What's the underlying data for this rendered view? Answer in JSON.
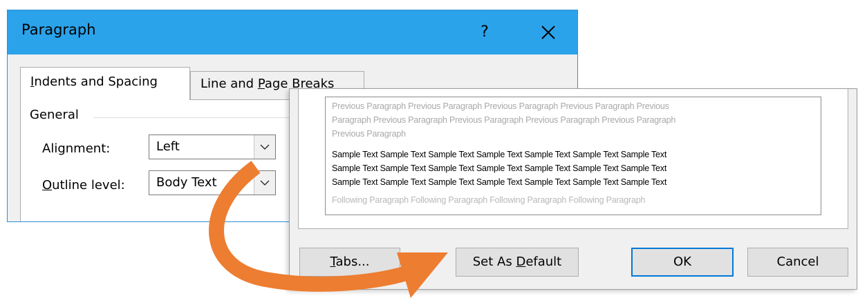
{
  "dialog": {
    "title": "Paragraph",
    "help_label": "?",
    "tabs": [
      {
        "pre": "",
        "ul": "I",
        "post": "ndents and Spacing"
      },
      {
        "pre": "Line and ",
        "ul": "P",
        "post": "age Breaks"
      }
    ],
    "general": {
      "group_label": "General",
      "alignment": {
        "pre": "Ali",
        "ul": "g",
        "post": "nment:",
        "value": "Left"
      },
      "outline_level": {
        "pre": "",
        "ul": "O",
        "post": "utline level:",
        "value": "Body Text"
      }
    }
  },
  "preview": {
    "previous_lines": [
      "Previous Paragraph Previous Paragraph Previous Paragraph Previous Paragraph Previous",
      "Paragraph Previous Paragraph Previous Paragraph Previous Paragraph Previous Paragraph",
      "Previous Paragraph"
    ],
    "sample_lines": [
      "Sample Text Sample Text Sample Text Sample Text Sample Text Sample Text Sample Text",
      "Sample Text Sample Text Sample Text Sample Text Sample Text Sample Text Sample Text",
      "Sample Text Sample Text Sample Text Sample Text Sample Text Sample Text Sample Text"
    ],
    "following_line": "Following Paragraph Following Paragraph Following Paragraph Following Paragraph"
  },
  "buttons": {
    "tabs": {
      "pre": "",
      "ul": "T",
      "post": "abs..."
    },
    "set_default": {
      "pre": "Set As ",
      "ul": "D",
      "post": "efault"
    },
    "ok": "OK",
    "cancel": "Cancel"
  },
  "colors": {
    "titlebar": "#2ba3eb",
    "arrow": "#ed7d31",
    "ok_border": "#0078d7"
  },
  "icons": {
    "close": "close-icon",
    "dropdown": "chevron-down-icon",
    "annotation": "curved-arrow-icon"
  }
}
